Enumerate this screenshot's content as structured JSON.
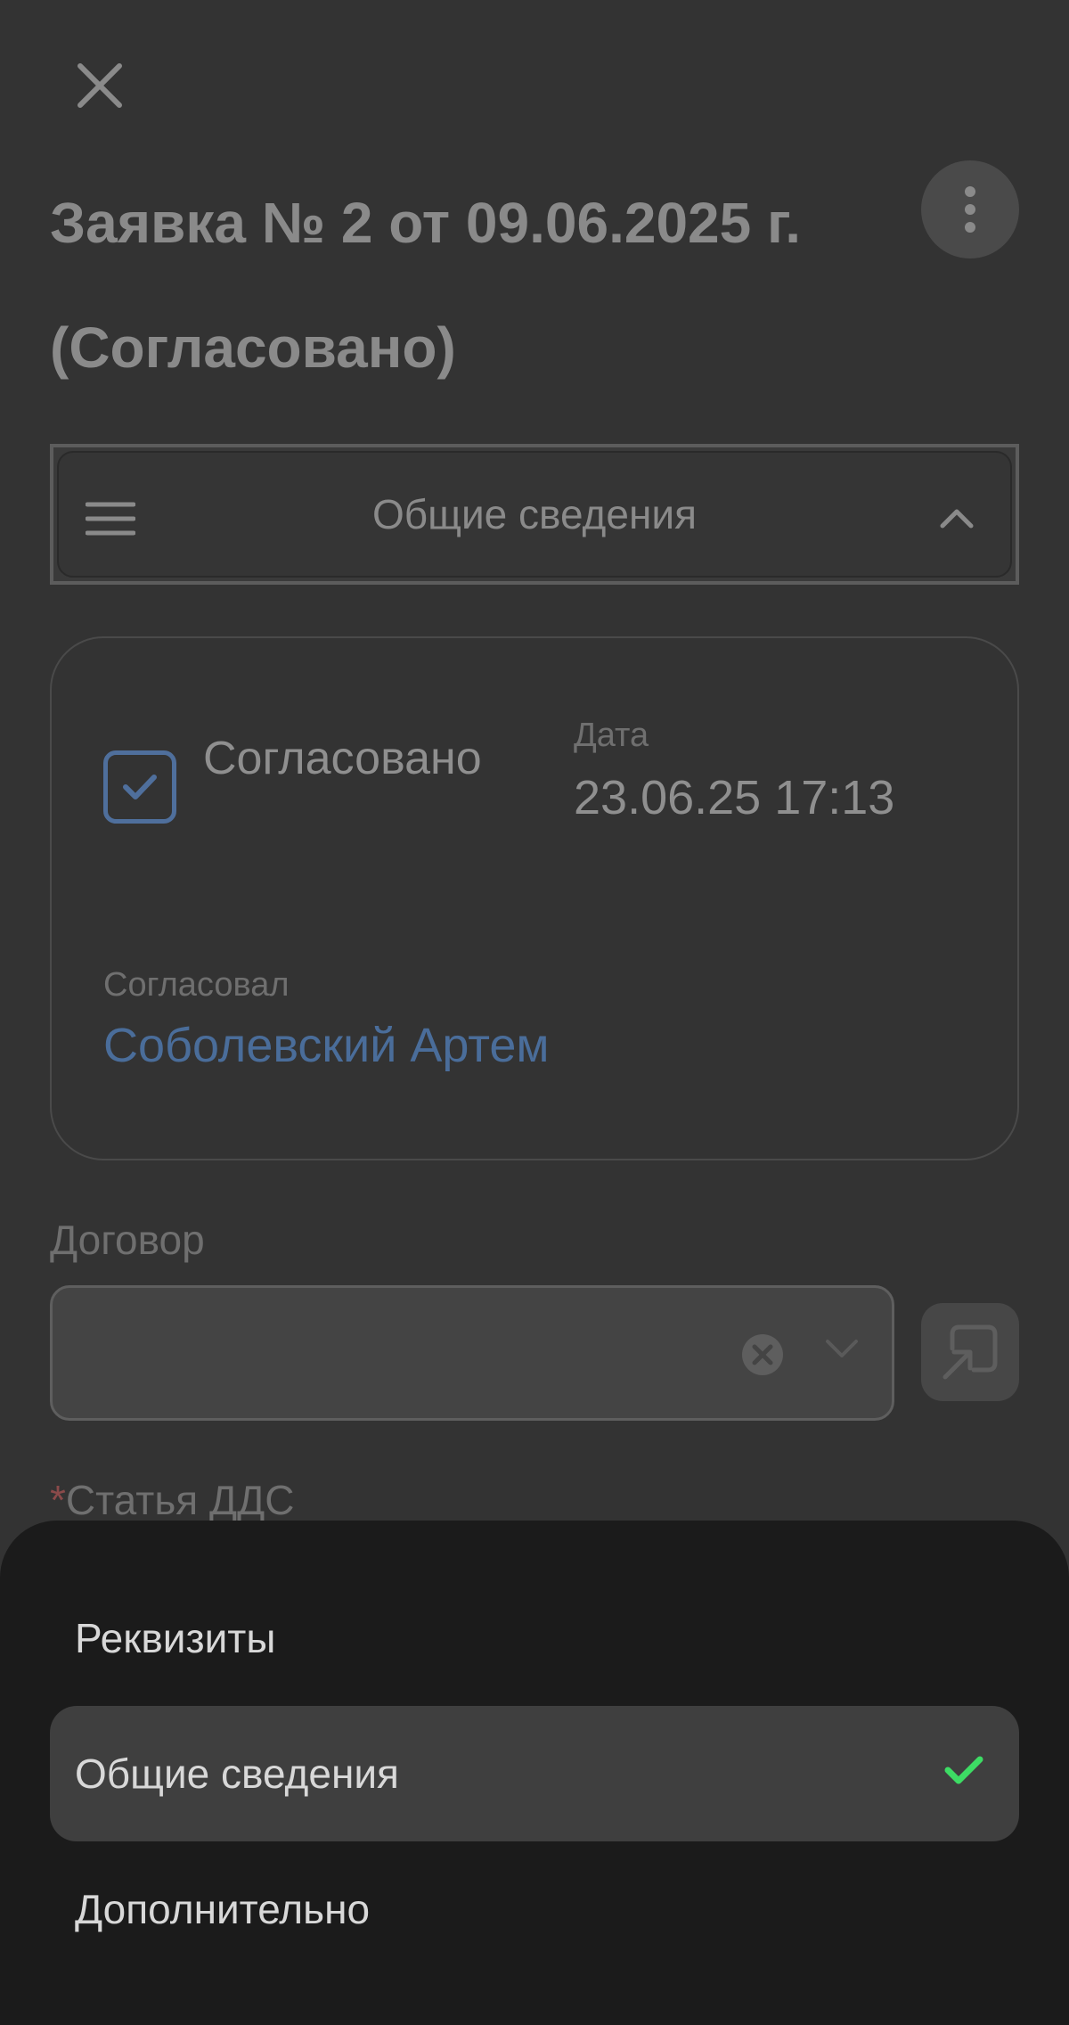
{
  "header": {
    "title": "Заявка № 2 от 09.06.2025 г. (Согласовано)"
  },
  "section_selector": {
    "label": "Общие сведения"
  },
  "approval_card": {
    "approved_label": "Согласовано",
    "date_caption": "Дата",
    "date_value": "23.06.25 17:13",
    "approver_caption": "Согласовал",
    "approver_name": "Соболевский Артем"
  },
  "contract": {
    "label": "Договор",
    "value": ""
  },
  "dds": {
    "required_mark": "*",
    "label": "Статья ДДС"
  },
  "bottom_sheet": {
    "options": [
      {
        "label": "Реквизиты",
        "selected": false
      },
      {
        "label": "Общие сведения",
        "selected": true
      },
      {
        "label": "Дополнительно",
        "selected": false
      }
    ]
  },
  "colors": {
    "background": "#333333",
    "sheet": "#1b1b1b",
    "accent_blue": "#4a6d9a",
    "check_green": "#3ddc64",
    "required_red": "#8a4a4a"
  }
}
